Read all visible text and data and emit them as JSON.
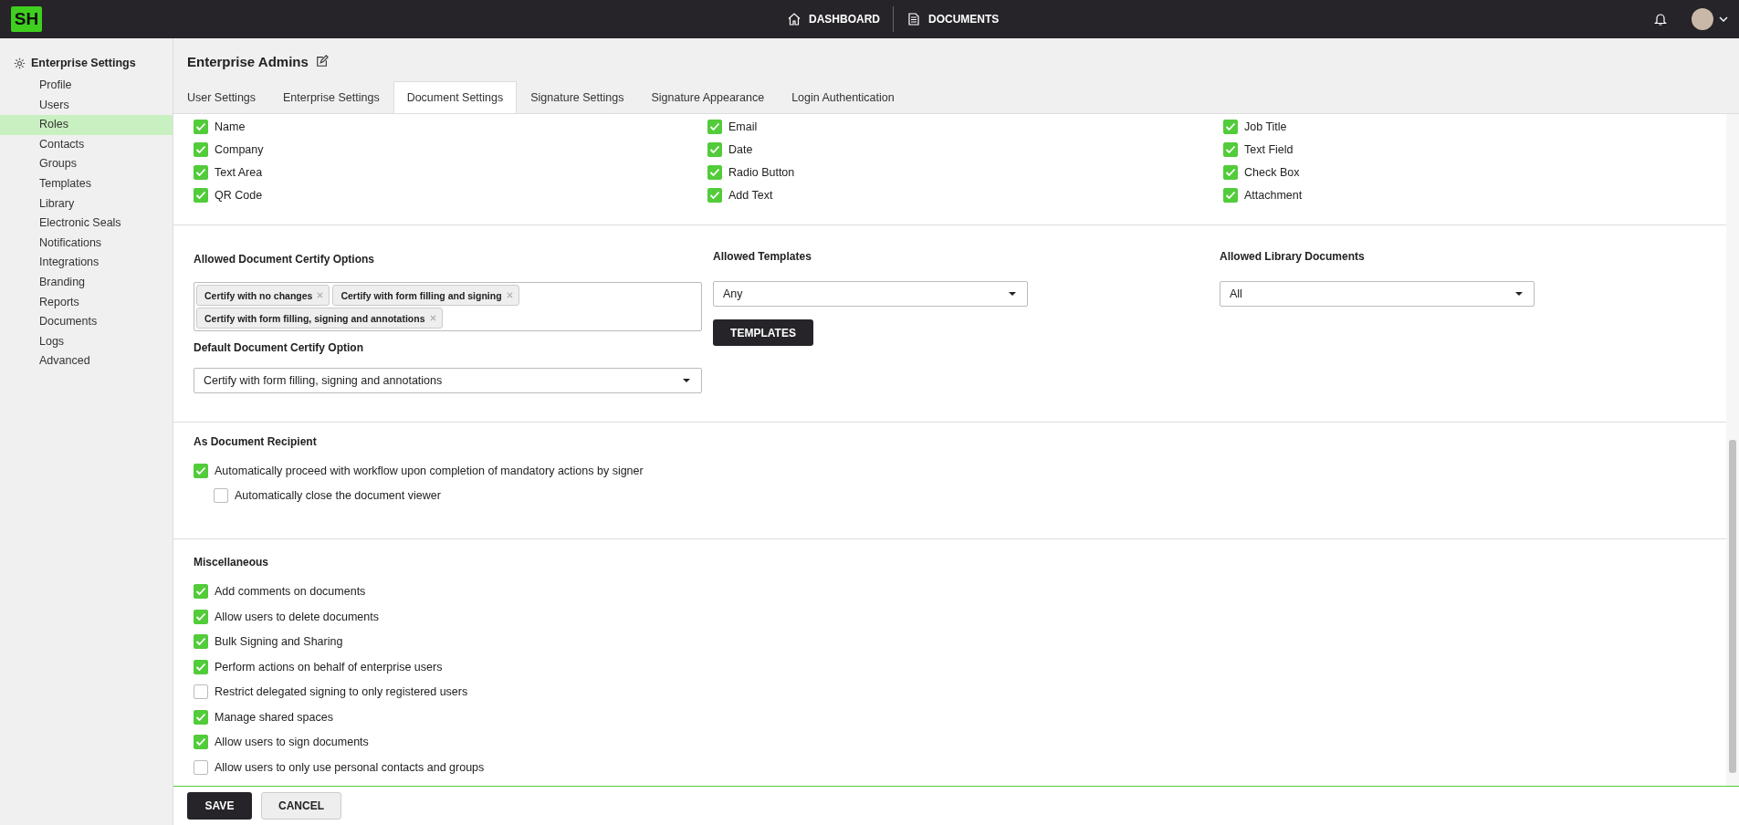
{
  "topbar": {
    "logo": "SH",
    "nav": [
      {
        "label": "DASHBOARD",
        "kind": "home"
      },
      {
        "label": "DOCUMENTS",
        "kind": "document"
      }
    ]
  },
  "sidebar": {
    "title": "Enterprise Settings",
    "items": [
      {
        "label": "Profile",
        "selected": false
      },
      {
        "label": "Users",
        "selected": false
      },
      {
        "label": "Roles",
        "selected": true
      },
      {
        "label": "Contacts",
        "selected": false
      },
      {
        "label": "Groups",
        "selected": false
      },
      {
        "label": "Templates",
        "selected": false
      },
      {
        "label": "Library",
        "selected": false
      },
      {
        "label": "Electronic Seals",
        "selected": false
      },
      {
        "label": "Notifications",
        "selected": false
      },
      {
        "label": "Integrations",
        "selected": false
      },
      {
        "label": "Branding",
        "selected": false
      },
      {
        "label": "Reports",
        "selected": false
      },
      {
        "label": "Documents",
        "selected": false
      },
      {
        "label": "Logs",
        "selected": false
      },
      {
        "label": "Advanced",
        "selected": false
      }
    ]
  },
  "header": {
    "title": "Enterprise Admins"
  },
  "tabs": [
    {
      "label": "User Settings",
      "selected": false
    },
    {
      "label": "Enterprise Settings",
      "selected": false
    },
    {
      "label": "Document Settings",
      "selected": true
    },
    {
      "label": "Signature Settings",
      "selected": false
    },
    {
      "label": "Signature Appearance",
      "selected": false
    },
    {
      "label": "Login Authentication",
      "selected": false
    }
  ],
  "fields": [
    {
      "label": "Name",
      "checked": true
    },
    {
      "label": "Email",
      "checked": true
    },
    {
      "label": "Job Title",
      "checked": true
    },
    {
      "label": "Company",
      "checked": true
    },
    {
      "label": "Date",
      "checked": true
    },
    {
      "label": "Text Field",
      "checked": true
    },
    {
      "label": "Text Area",
      "checked": true
    },
    {
      "label": "Radio Button",
      "checked": true
    },
    {
      "label": "Check Box",
      "checked": true
    },
    {
      "label": "QR Code",
      "checked": true
    },
    {
      "label": "Add Text",
      "checked": true
    },
    {
      "label": "Attachment",
      "checked": true
    }
  ],
  "certify": {
    "allowed_label": "Allowed Document Certify Options",
    "allowed_tags": [
      "Certify with no changes",
      "Certify with form filling and signing",
      "Certify with form filling, signing and annotations"
    ],
    "default_label": "Default Document Certify Option",
    "default_value": "Certify with form filling, signing and annotations"
  },
  "templates": {
    "label": "Allowed Templates",
    "value": "Any",
    "button": "TEMPLATES"
  },
  "library": {
    "label": "Allowed Library Documents",
    "value": "All"
  },
  "recipient": {
    "title": "As Document Recipient",
    "options": [
      {
        "label": "Automatically proceed with workflow upon completion of mandatory actions by signer",
        "checked": true,
        "children": [
          {
            "label": "Automatically close the document viewer",
            "checked": false
          }
        ]
      }
    ]
  },
  "misc": {
    "title": "Miscellaneous",
    "options": [
      {
        "label": "Add comments on documents",
        "checked": true
      },
      {
        "label": "Allow users to delete documents",
        "checked": true
      },
      {
        "label": "Bulk Signing and Sharing",
        "checked": true
      },
      {
        "label": "Perform actions on behalf of enterprise users",
        "checked": true
      },
      {
        "label": "Restrict delegated signing to only registered users",
        "checked": false
      },
      {
        "label": "Manage shared spaces",
        "checked": true
      },
      {
        "label": "Allow users to sign documents",
        "checked": true
      },
      {
        "label": "Allow users to only use personal contacts and groups",
        "checked": false
      }
    ]
  },
  "footer": {
    "save": "SAVE",
    "cancel": "CANCEL"
  }
}
